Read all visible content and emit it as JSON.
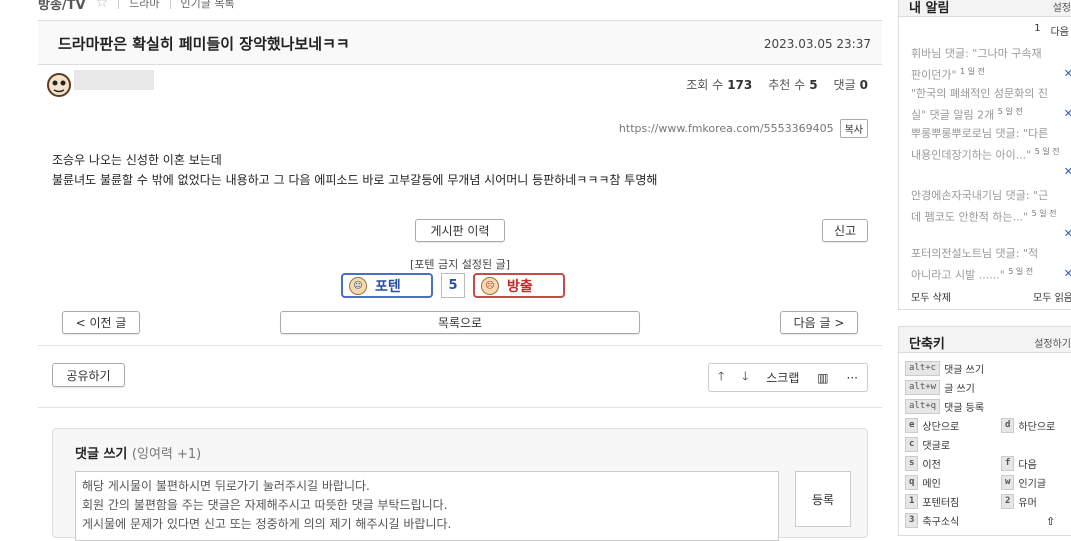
{
  "breadcrumb": {
    "category": "방송/TV",
    "sub": "드라마",
    "popular": "인기글 목록"
  },
  "post": {
    "title": "드라마판은 확실히 페미들이 장악했나보네ㅋㅋ",
    "date": "2023.03.05 23:37",
    "views_label": "조회 수",
    "views": "173",
    "recommend_label": "추천 수",
    "recommend": "5",
    "comments_label": "댓글",
    "comments": "0",
    "url": "https://www.fmkorea.com/5553369405",
    "copy_label": "복사",
    "body_lines": [
      "조승우 나오는 신성한 이혼 보는데",
      "불륜녀도 불륜할 수 밖에 없었다는 내용하고 그 다음 에피소드 바로 고부갈등에 무개념 시어머니 등판하네ㅋㅋㅋ참 투명해"
    ]
  },
  "actions": {
    "history": "게시판 이력",
    "report": "신고",
    "notice": "[포텐 금지 설정된 글]",
    "vote_up": "포텐",
    "vote_count": "5",
    "vote_down": "방출",
    "prev": "< 이전 글",
    "list": "목록으로",
    "next": "다음 글 >",
    "share": "공유하기",
    "scrap": "스크랩"
  },
  "comment": {
    "title": "댓글 쓰기",
    "surplus": "(잉여력 +1)",
    "placeholder_lines": [
      "해당 게시물이 불편하시면 뒤로가기 눌러주시길 바랍니다.",
      "회원 간의 불편함을 주는 댓글은 자제해주시고 따뜻한 댓글 부탁드립니다.",
      "게시물에 문제가 있다면 신고 또는 정중하게 의의 제기 해주시길 바랍니다."
    ],
    "submit": "등록"
  },
  "notifications": {
    "title": "내 알림",
    "settings": "설정",
    "page": "1",
    "next": "다음",
    "items": [
      {
        "lines": [
          "휘바님 댓글: \"그나마 구속재",
          "판이던가\""
        ],
        "rel": "1 일 전"
      },
      {
        "lines": [
          "\"한국의 폐쇄적인 성문화의 진",
          "실\" 댓글 알림 2개"
        ],
        "rel": "5 일 전"
      },
      {
        "lines": [
          "뿌롱뿌롱뿌로로님 댓글: \"다른",
          "내용인데장기하는 아이...\""
        ],
        "rel": "5 일 전"
      },
      {
        "lines": [
          "안경에손자국내기님 댓글: \"근",
          "데 펨코도 안한적 하는...\""
        ],
        "rel": "5 일 전"
      },
      {
        "lines": [
          "포터의전설노트님 댓글: \"적",
          "아니라고 시발 ......\""
        ],
        "rel": "5 일 전"
      }
    ],
    "delete_all": "모두 삭제",
    "read_all": "모두 읽음"
  },
  "shortcuts": {
    "title": "단축키",
    "settings": "설정하기",
    "keys": [
      {
        "key": "alt+c",
        "label": "댓글 쓰기"
      },
      {
        "key": "alt+w",
        "label": "글 쓰기"
      },
      {
        "key": "alt+q",
        "label": "댓글 등록"
      },
      {
        "key": "e",
        "label": "상단으로"
      },
      {
        "key": "d",
        "label": "하단으로"
      },
      {
        "key": "c",
        "label": "댓글로"
      },
      {
        "key": "s",
        "label": "이전"
      },
      {
        "key": "f",
        "label": "다음"
      },
      {
        "key": "q",
        "label": "메인"
      },
      {
        "key": "w",
        "label": "인기글"
      },
      {
        "key": "1",
        "label": "포텐터짐"
      },
      {
        "key": "2",
        "label": "유머"
      },
      {
        "key": "3",
        "label": "축구소식"
      }
    ]
  }
}
